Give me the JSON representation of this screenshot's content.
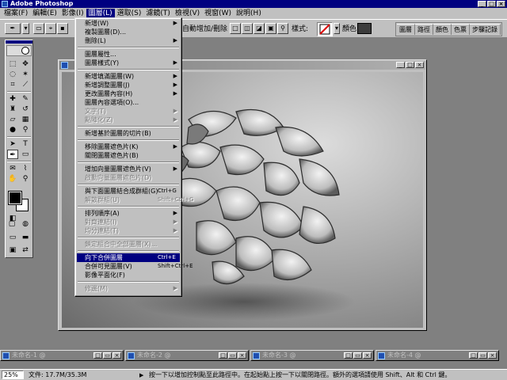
{
  "app": {
    "title": "Adobe Photoshop"
  },
  "menubar": {
    "items": [
      "檔案(F)",
      "編輯(E)",
      "影像(I)",
      "圖層(L)",
      "選取(S)",
      "濾鏡(T)",
      "檢視(V)",
      "視窗(W)",
      "說明(H)"
    ]
  },
  "options": {
    "auto_select_label": "自動增加/刪除",
    "style_label": "樣式:",
    "color_label": "顏色:",
    "palette_tabs": [
      "圖層",
      "路徑",
      "顏色",
      "色票",
      "步驟記錄"
    ]
  },
  "layer_menu": {
    "items": [
      {
        "label": "新增(W)",
        "shortcut": "",
        "submenu": true,
        "disabled": false
      },
      {
        "label": "複製圖層(D)...",
        "shortcut": "",
        "submenu": false,
        "disabled": false
      },
      {
        "label": "刪除(L)",
        "shortcut": "",
        "submenu": true,
        "disabled": false
      },
      {
        "separator": true
      },
      {
        "label": "圖層屬性...",
        "shortcut": "",
        "submenu": false,
        "disabled": false
      },
      {
        "label": "圖層樣式(Y)",
        "shortcut": "",
        "submenu": true,
        "disabled": false
      },
      {
        "separator": true
      },
      {
        "label": "新增填滿圖層(W)",
        "shortcut": "",
        "submenu": true,
        "disabled": false
      },
      {
        "label": "新增調整圖層(J)",
        "shortcut": "",
        "submenu": true,
        "disabled": false
      },
      {
        "label": "更改圖層內容(H)",
        "shortcut": "",
        "submenu": true,
        "disabled": false
      },
      {
        "label": "圖層內容選項(O)...",
        "shortcut": "",
        "submenu": false,
        "disabled": false
      },
      {
        "label": "文字(T)",
        "shortcut": "",
        "submenu": true,
        "disabled": true
      },
      {
        "label": "點陣化(Z)",
        "shortcut": "",
        "submenu": true,
        "disabled": true
      },
      {
        "separator": true
      },
      {
        "label": "新增基於圖層的切片(B)",
        "shortcut": "",
        "submenu": false,
        "disabled": false
      },
      {
        "separator": true
      },
      {
        "label": "移除圖層遮色片(K)",
        "shortcut": "",
        "submenu": true,
        "disabled": false
      },
      {
        "label": "關閉圖層遮色片(B)",
        "shortcut": "",
        "submenu": false,
        "disabled": false
      },
      {
        "separator": true
      },
      {
        "label": "增加向量圖層遮色片(V)",
        "shortcut": "",
        "submenu": true,
        "disabled": false
      },
      {
        "label": "啟動向量圖層遮色片(D)",
        "shortcut": "",
        "submenu": false,
        "disabled": true
      },
      {
        "separator": true
      },
      {
        "label": "與下面圖層結合成群組(G)",
        "shortcut": "Ctrl+G",
        "submenu": false,
        "disabled": false
      },
      {
        "label": "解散群組(U)",
        "shortcut": "Shift+Ctrl+G",
        "submenu": false,
        "disabled": true
      },
      {
        "separator": true
      },
      {
        "label": "排列順序(A)",
        "shortcut": "",
        "submenu": true,
        "disabled": false
      },
      {
        "label": "對齊連結(I)",
        "shortcut": "",
        "submenu": true,
        "disabled": true
      },
      {
        "label": "均分連結(T)",
        "shortcut": "",
        "submenu": true,
        "disabled": true
      },
      {
        "separator": true
      },
      {
        "label": "鎖定組合中全部圖層(X)...",
        "shortcut": "",
        "submenu": false,
        "disabled": true
      },
      {
        "separator": true
      },
      {
        "label": "向下合併圖層",
        "shortcut": "Ctrl+E",
        "submenu": false,
        "disabled": false,
        "highlight": true
      },
      {
        "label": "合併可見圖層(V)",
        "shortcut": "Shift+Ctrl+E",
        "submenu": false,
        "disabled": false
      },
      {
        "label": "影像平面化(F)",
        "shortcut": "",
        "submenu": false,
        "disabled": false
      },
      {
        "separator": true
      },
      {
        "label": "修邊(M)",
        "shortcut": "",
        "submenu": true,
        "disabled": true
      }
    ]
  },
  "minimized_windows": [
    "未命名-1 @",
    "未命名-2 @",
    "未命名-3 @",
    "未命名-4 @"
  ],
  "statusbar": {
    "zoom": "25%",
    "doc_info": "文件: 17.7M/35.3M",
    "hint": "按一下以增加控制點至此路徑中。在起始點上按一下以關閉路徑。額外的選項請使用 Shift、Alt 和 Ctrl 鍵。"
  },
  "colors": {
    "titlebar": "#000080",
    "chrome": "#c0c0c0",
    "highlight": "#000080",
    "desktop": "#808080"
  }
}
